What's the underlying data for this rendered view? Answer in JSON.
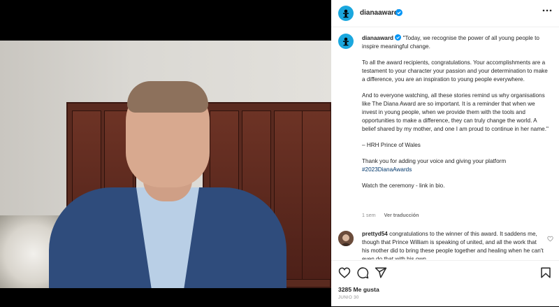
{
  "post": {
    "account": "dianaaward",
    "caption": {
      "username": "dianaaward",
      "lines": [
        "\"Today, we recognise the power of all young people to inspire meaningful change.",
        "To all the award recipients, congratulations. Your accomplishments are a testament to your character your passion and your determination to make a difference, you are an inspiration to young people everywhere.",
        "And to everyone watching, all these stories remind us why organisations like The Diana Award are so important. It is a reminder that when we invest in young people, when we provide them with the tools and opportunities to make a difference, they can truly change the world. A belief shared by my mother, and one I am proud to continue in her name.\"",
        "– HRH Prince of Wales"
      ],
      "thanks": "Thank you for adding your voice and giving your platform",
      "hashtag": "#2023DianaAwards",
      "closing": "Watch the ceremony - link in bio."
    },
    "age": "1 sem",
    "translate": "Ver traducción",
    "comment": {
      "username": "prettyd54",
      "text": "congratulations to the winner of this award. It saddens me, though that Prince William is speaking of united, and all the work that his mother did to bring these people together and healing when he can't even do that with his own"
    },
    "likes": "3285 Me gusta",
    "date": "JUNIO 30"
  },
  "icons": {
    "more": "more-icon",
    "like": "heart-icon",
    "comment": "comment-icon",
    "share": "share-icon",
    "save": "bookmark-icon",
    "verified": "verified-icon"
  },
  "colors": {
    "brand": "#1aa7de",
    "verified": "#0095f6",
    "hashtag": "#00376b"
  }
}
